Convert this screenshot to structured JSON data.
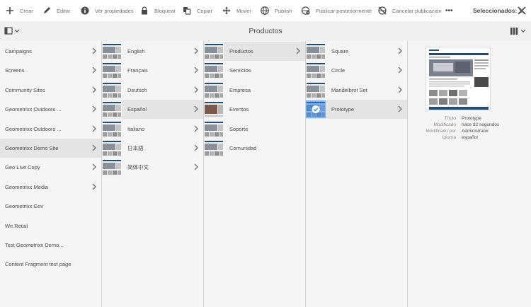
{
  "actions": [
    {
      "label": "Crear",
      "icon": "plus-icon"
    },
    {
      "label": "Editar",
      "icon": "pencil-icon"
    },
    {
      "label": "Ver propiedades",
      "icon": "info-icon"
    },
    {
      "label": "Bloquear",
      "icon": "lock-icon"
    },
    {
      "label": "Copiar",
      "icon": "copy-icon"
    },
    {
      "label": "Mover",
      "icon": "move-icon"
    },
    {
      "label": "Publish",
      "icon": "globe-icon"
    },
    {
      "label": "Publicar posteriormente",
      "icon": "globe-clock-icon"
    },
    {
      "label": "Cancelar publicación",
      "icon": "globe-off-icon"
    }
  ],
  "more_label": "•••",
  "selection_label": "Seleccionados: 1",
  "page_title": "Productos",
  "col1": [
    {
      "label": "Campaigns",
      "chevron": true
    },
    {
      "label": "Screens",
      "chevron": true
    },
    {
      "label": "Community Sites",
      "chevron": true
    },
    {
      "label": "Geometrixx Outdoors ...",
      "chevron": true
    },
    {
      "label": "Geometrixx Outdoors ...",
      "chevron": true
    },
    {
      "label": "Geometrixx Demo Site",
      "chevron": true,
      "active": true
    },
    {
      "label": "Geo Live Copy",
      "chevron": true
    },
    {
      "label": "Geometrixx Media",
      "chevron": true
    },
    {
      "label": "Geometrixx Gov",
      "chevron": false
    },
    {
      "label": "We.Retail",
      "chevron": false
    },
    {
      "label": "Test Geometrixx Demo...",
      "chevron": false
    },
    {
      "label": "Content Fragment test page",
      "chevron": false
    }
  ],
  "col2": [
    {
      "label": "English",
      "chevron": true
    },
    {
      "label": "Français",
      "chevron": true
    },
    {
      "label": "Deutsch",
      "chevron": true
    },
    {
      "label": "Español",
      "chevron": true,
      "active": true
    },
    {
      "label": "Italiano",
      "chevron": true
    },
    {
      "label": "日本語",
      "chevron": true
    },
    {
      "label": "简体中文",
      "chevron": true
    }
  ],
  "col3": [
    {
      "label": "Productos",
      "chevron": true,
      "active": true
    },
    {
      "label": "Servicios",
      "chevron": false
    },
    {
      "label": "Empresa",
      "chevron": false
    },
    {
      "label": "Eventos",
      "chevron": false,
      "dark": true
    },
    {
      "label": "Soporte",
      "chevron": false
    },
    {
      "label": "Comunidad",
      "chevron": false
    }
  ],
  "col4": [
    {
      "label": "Square",
      "chevron": true
    },
    {
      "label": "Circle",
      "chevron": true
    },
    {
      "label": "Mandelbrot Set",
      "chevron": true
    },
    {
      "label": "Prototype",
      "chevron": true,
      "active": true,
      "selected": true
    }
  ],
  "preview": {
    "meta": [
      {
        "key": "Título",
        "value": "Prototype"
      },
      {
        "key": "Modificado",
        "value": "hace 32 segundos"
      },
      {
        "key": "Modificado por",
        "value": "Administrator"
      },
      {
        "key": "Idioma",
        "value": "español"
      }
    ]
  },
  "colors": {
    "accent": "#2680eb",
    "selected_bg": "#e4e4e4",
    "column_bg": "#f5f5f5",
    "titlebar_bg": "#f0f0f0"
  }
}
